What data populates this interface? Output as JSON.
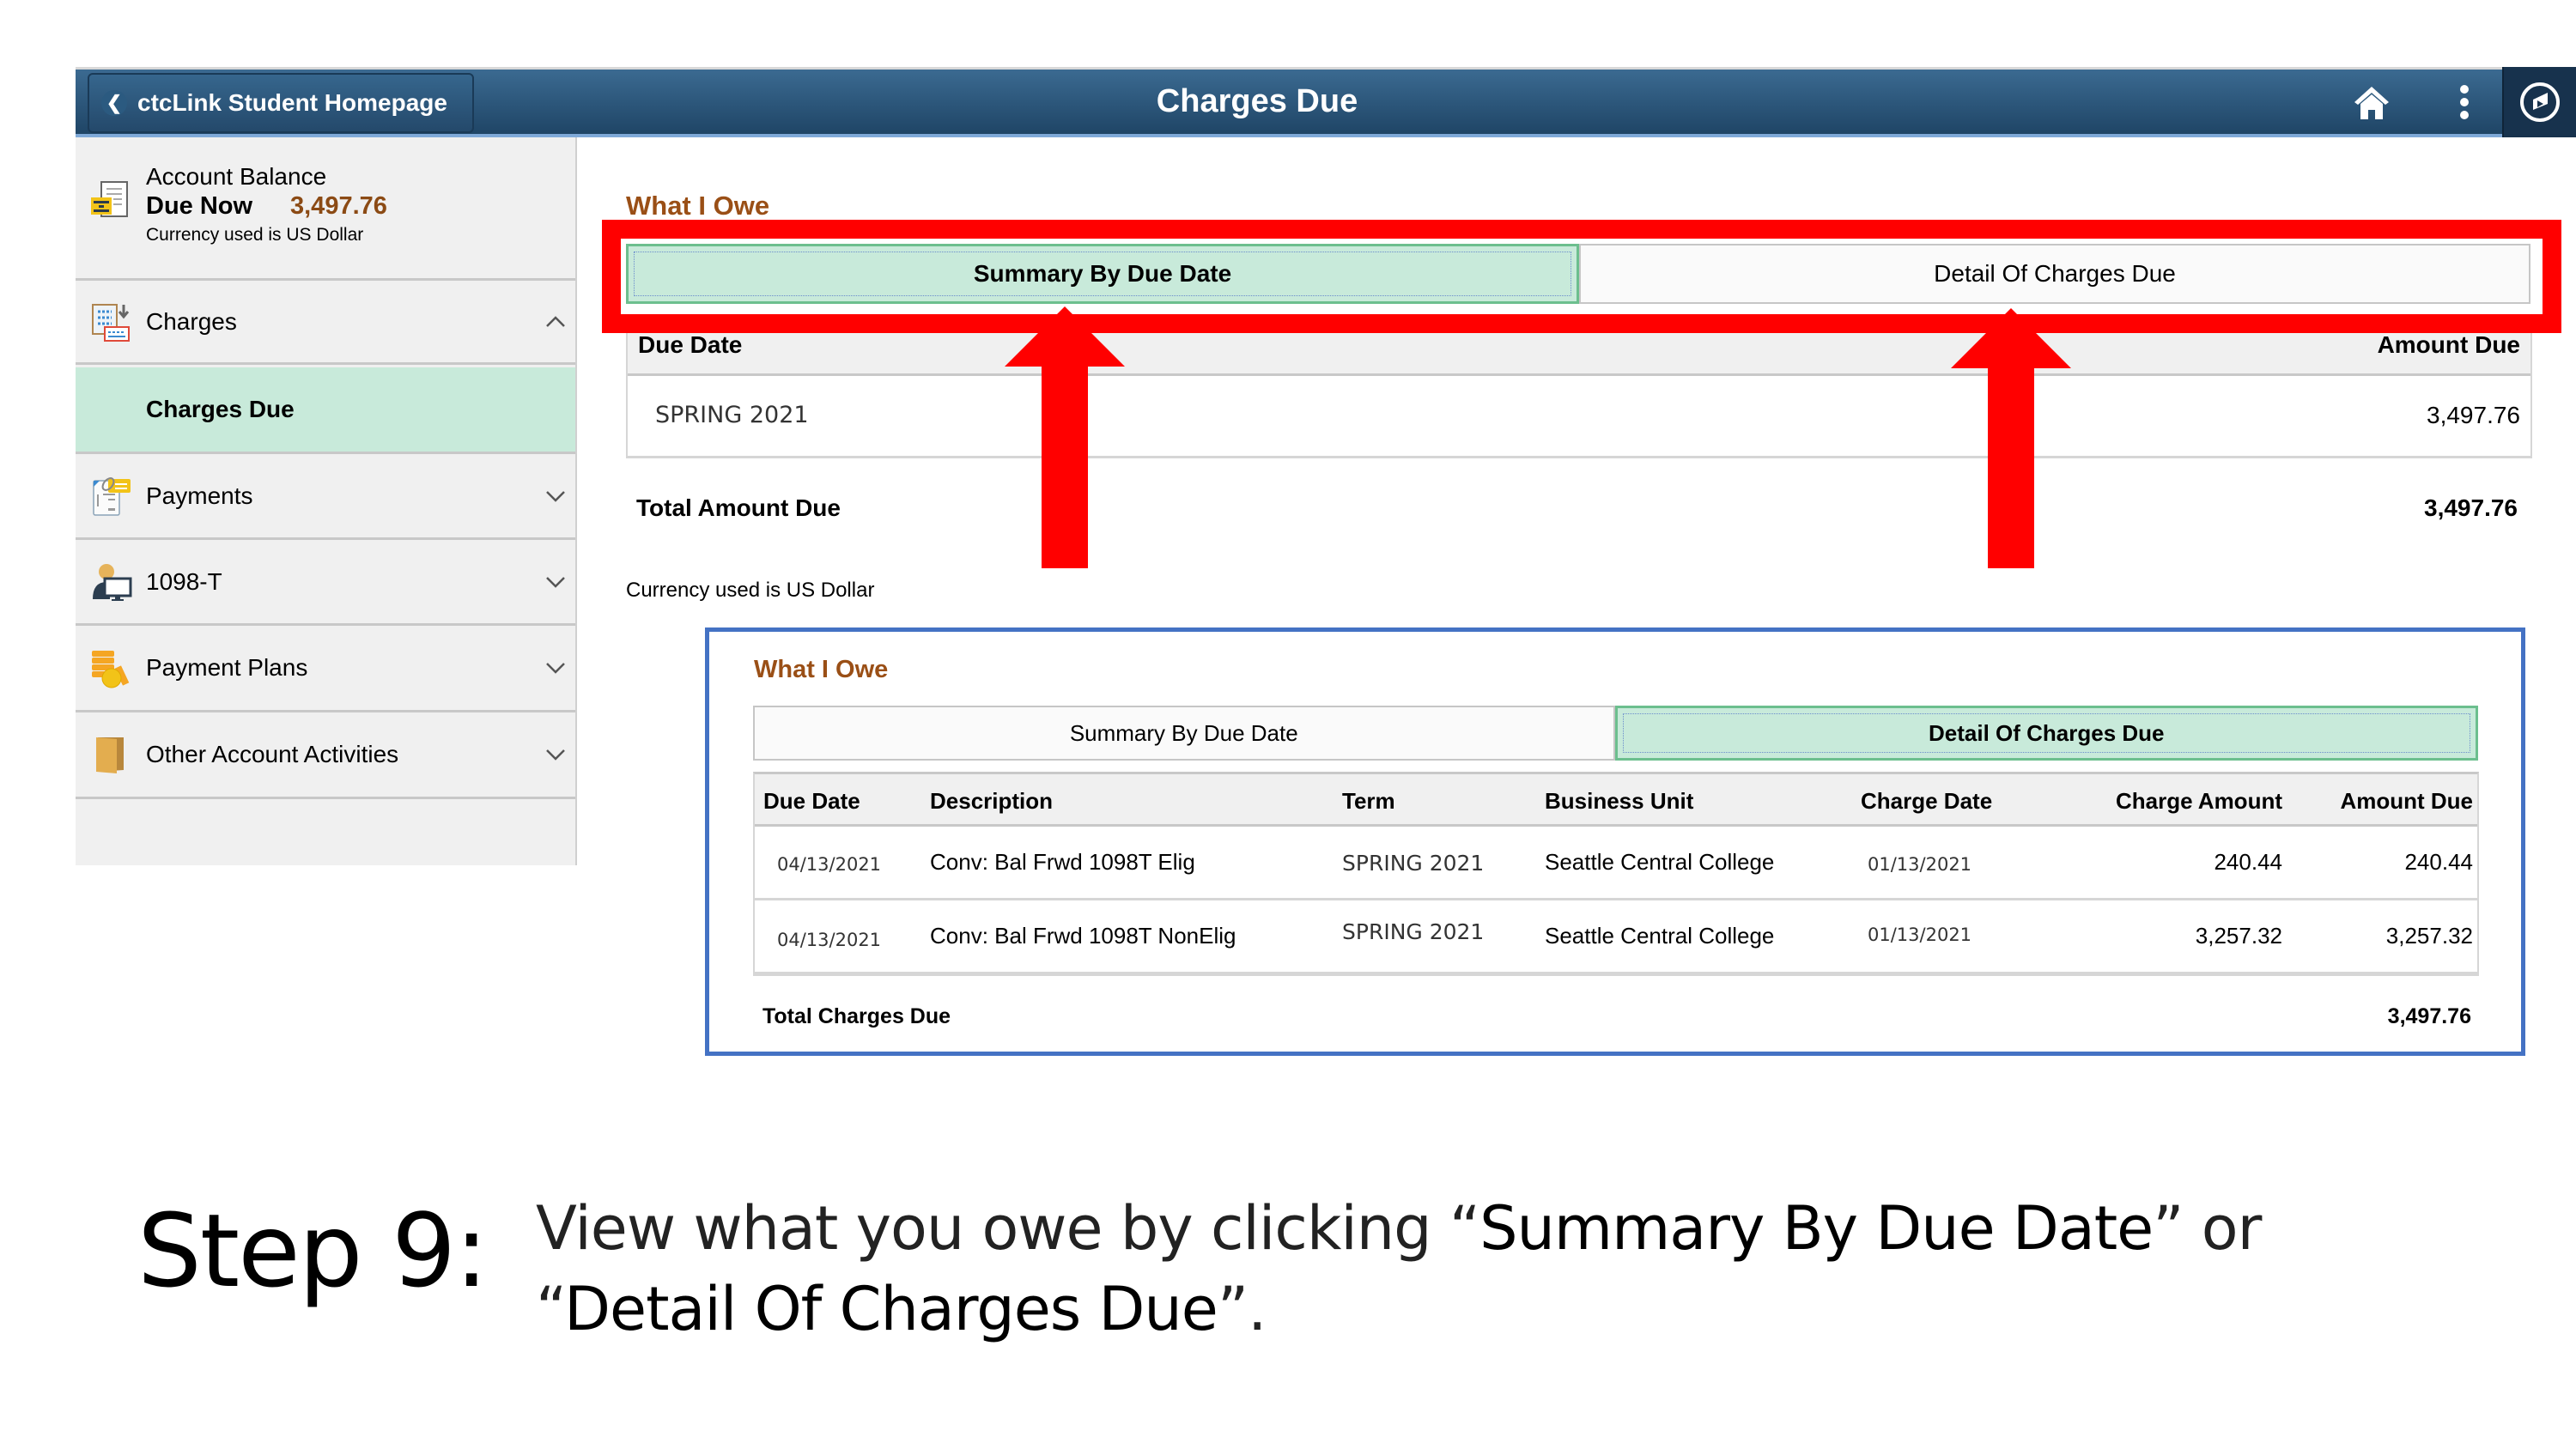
{
  "header": {
    "back_label": "ctcLink Student Homepage",
    "title": "Charges Due",
    "icons": [
      "home-icon",
      "more-options-icon",
      "navbar-compass-icon"
    ]
  },
  "sidebar": {
    "account": {
      "title": "Account Balance",
      "due_label": "Due Now",
      "due_amount": "3,497.76",
      "currency_note": "Currency used is US Dollar",
      "icon": "account-balance-icon"
    },
    "items": [
      {
        "label": "Charges",
        "icon": "charges-icon",
        "state": "expanded"
      },
      {
        "label": "Charges Due",
        "icon": "",
        "state": "selected"
      },
      {
        "label": "Payments",
        "icon": "payments-icon",
        "state": "collapsed"
      },
      {
        "label": "1098-T",
        "icon": "1098t-icon",
        "state": "collapsed"
      },
      {
        "label": "Payment Plans",
        "icon": "payment-plans-icon",
        "state": "collapsed"
      },
      {
        "label": "Other Account Activities",
        "icon": "folder-icon",
        "state": "collapsed"
      }
    ]
  },
  "summary_view": {
    "section_title": "What I Owe",
    "tabs": [
      {
        "label": "Summary By Due Date",
        "active": true
      },
      {
        "label": "Detail Of Charges Due",
        "active": false
      }
    ],
    "columns": [
      "Due Date",
      "Amount Due"
    ],
    "rows": [
      {
        "due_date": "SPRING 2021",
        "amount_due": "3,497.76"
      }
    ],
    "total_label": "Total Amount Due",
    "total_value": "3,497.76",
    "currency_note": "Currency used is US Dollar"
  },
  "detail_view": {
    "section_title": "What I Owe",
    "tabs": [
      {
        "label": "Summary By Due Date",
        "active": false
      },
      {
        "label": "Detail Of Charges Due",
        "active": true
      }
    ],
    "columns": [
      "Due Date",
      "Description",
      "Term",
      "Business Unit",
      "Charge Date",
      "Charge Amount",
      "Amount Due"
    ],
    "rows": [
      {
        "due_date": "04/13/2021",
        "description": "Conv: Bal Frwd 1098T Elig",
        "term": "SPRING 2021",
        "business_unit": "Seattle Central College",
        "charge_date": "01/13/2021",
        "charge_amount": "240.44",
        "amount_due": "240.44"
      },
      {
        "due_date": "04/13/2021",
        "description": "Conv: Bal Frwd 1098T NonElig",
        "term": "SPRING 2021",
        "business_unit": "Seattle Central College",
        "charge_date": "01/13/2021",
        "charge_amount": "3,257.32",
        "amount_due": "3,257.32"
      }
    ],
    "total_label": "Total Charges Due",
    "total_value": "3,497.76"
  },
  "annotations": {
    "highlight_color": "#ff0000",
    "inset_border_color": "#4472c4"
  },
  "caption": {
    "step": "Step 9:",
    "text_plain_1": "View what you owe by clicking “",
    "text_em_1": "Summary By Due Date",
    "text_plain_2": "” or",
    "text_plain_3": "“",
    "text_em_2": "Detail Of Charges Due",
    "text_plain_4": "”."
  },
  "colors": {
    "header_blue": "#2c5679",
    "selected_green": "#c8eada",
    "amount_brown": "#8b4a14"
  }
}
